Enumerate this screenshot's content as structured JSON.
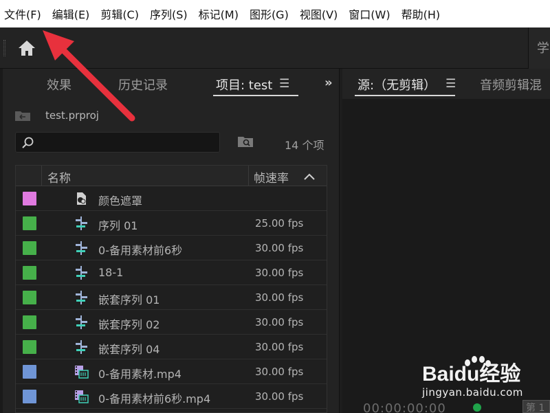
{
  "menu": [
    "文件(F)",
    "编辑(E)",
    "剪辑(C)",
    "序列(S)",
    "标记(M)",
    "图形(G)",
    "视图(V)",
    "窗口(W)",
    "帮助(H)"
  ],
  "toolbar": {
    "right_label": "学"
  },
  "project_panel": {
    "tabs": [
      "效果",
      "历史记录",
      "项目: test"
    ],
    "file_name": "test.prproj",
    "item_count": "14 个项",
    "columns": {
      "name": "名称",
      "fps": "帧速率"
    },
    "rows": [
      {
        "color": "#e07ae0",
        "icon": "matte-icon",
        "name": "颜色遮罩",
        "fps": ""
      },
      {
        "color": "#46b04a",
        "icon": "sequence-icon",
        "name": "序列 01",
        "fps": "25.00 fps"
      },
      {
        "color": "#46b04a",
        "icon": "sequence-icon",
        "name": "0-备用素材前6秒",
        "fps": "30.00 fps"
      },
      {
        "color": "#46b04a",
        "icon": "sequence-icon",
        "name": "18-1",
        "fps": "30.00 fps"
      },
      {
        "color": "#46b04a",
        "icon": "sequence-icon",
        "name": "嵌套序列 01",
        "fps": "30.00 fps"
      },
      {
        "color": "#46b04a",
        "icon": "sequence-icon",
        "name": "嵌套序列 02",
        "fps": "30.00 fps"
      },
      {
        "color": "#46b04a",
        "icon": "sequence-icon",
        "name": "嵌套序列 04",
        "fps": "30.00 fps"
      },
      {
        "color": "#6f95d6",
        "icon": "video-clip-icon",
        "name": "0-备用素材.mp4",
        "fps": "30.00 fps"
      },
      {
        "color": "#6f95d6",
        "icon": "video-clip-icon",
        "name": "0-备用素材前6秒.mp4",
        "fps": "30.00 fps"
      }
    ]
  },
  "source_panel": {
    "tabs": [
      "源:（无剪辑）",
      "音频剪辑混"
    ],
    "timecode": "00:00:00:00",
    "page_label": "第 1"
  },
  "watermark": {
    "brand": "Baidu经验",
    "url": "jingyan.baidu.com"
  },
  "colors": {
    "accent_arrow": "#e8313d",
    "status_green": "#1fa34a"
  }
}
